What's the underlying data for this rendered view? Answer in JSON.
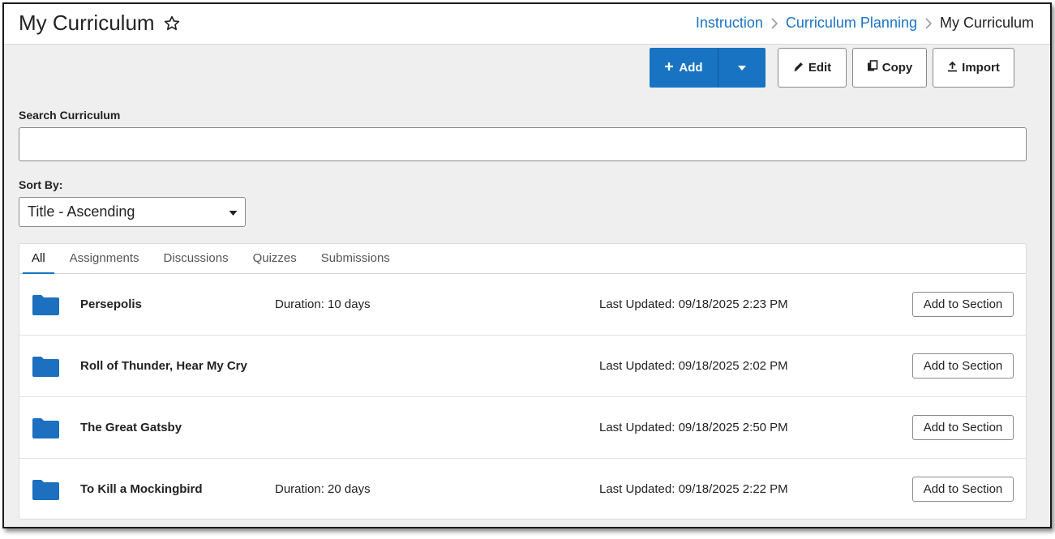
{
  "header": {
    "title": "My Curriculum",
    "favorite_icon": "star-outline-icon",
    "breadcrumb": [
      {
        "label": "Instruction",
        "link": true
      },
      {
        "label": "Curriculum Planning",
        "link": true
      },
      {
        "label": "My Curriculum",
        "link": false
      }
    ]
  },
  "toolbar": {
    "add_label": "Add",
    "edit_label": "Edit",
    "copy_label": "Copy",
    "import_label": "Import"
  },
  "search": {
    "label": "Search Curriculum",
    "value": "",
    "placeholder": ""
  },
  "sort": {
    "label": "Sort By:",
    "selected": "Title - Ascending"
  },
  "tabs": [
    {
      "label": "All",
      "active": true
    },
    {
      "label": "Assignments",
      "active": false
    },
    {
      "label": "Discussions",
      "active": false
    },
    {
      "label": "Quizzes",
      "active": false
    },
    {
      "label": "Submissions",
      "active": false
    }
  ],
  "items": [
    {
      "title": "Persepolis",
      "duration": "Duration: 10 days",
      "updated": "Last Updated: 09/18/2025 2:23 PM",
      "action": "Add to Section",
      "icon": "folder-icon"
    },
    {
      "title": "Roll of Thunder, Hear My Cry",
      "duration": "",
      "updated": "Last Updated: 09/18/2025 2:02 PM",
      "action": "Add to Section",
      "icon": "folder-icon"
    },
    {
      "title": "The Great Gatsby",
      "duration": "",
      "updated": "Last Updated: 09/18/2025 2:50 PM",
      "action": "Add to Section",
      "icon": "folder-icon"
    },
    {
      "title": "To Kill a Mockingbird",
      "duration": "Duration: 20 days",
      "updated": "Last Updated: 09/18/2025 2:22 PM",
      "action": "Add to Section",
      "icon": "folder-icon"
    }
  ],
  "colors": {
    "accent": "#1873c2",
    "link": "#1a73c5",
    "folder": "#1d6fbf",
    "background": "#efefef"
  }
}
